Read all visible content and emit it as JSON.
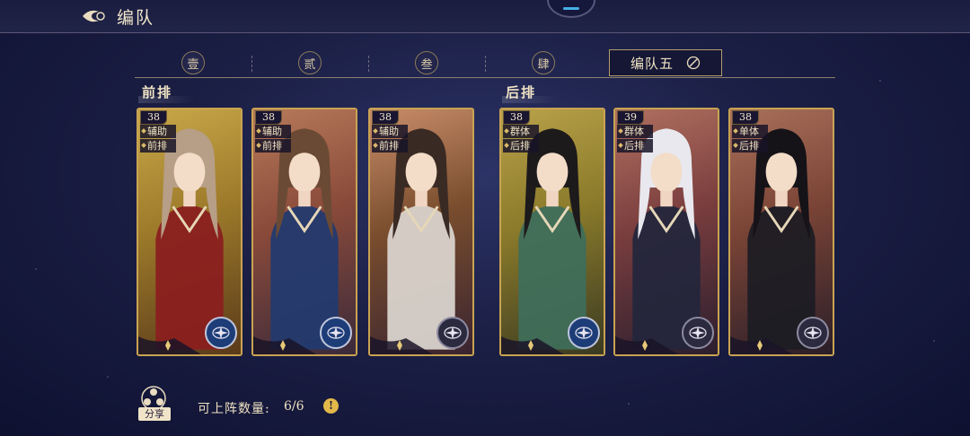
{
  "header": {
    "title": "编队"
  },
  "tabs": [
    {
      "label": "壹"
    },
    {
      "label": "贰"
    },
    {
      "label": "叁"
    },
    {
      "label": "肆"
    },
    {
      "label": "编队五",
      "active": true
    }
  ],
  "sections": {
    "front": "前排",
    "back": "后排"
  },
  "cards": [
    {
      "level": "38",
      "role": "辅助",
      "row": "前排",
      "palette": [
        "#9c7a2a",
        "#c9a84a",
        "#5a3a1a"
      ],
      "hair": "#b79e86",
      "outfit": "#8a1f1f",
      "compass": "blue"
    },
    {
      "level": "38",
      "role": "辅助",
      "row": "前排",
      "palette": [
        "#8a4a3a",
        "#b77a5a",
        "#3a2a3a"
      ],
      "hair": "#6b4a35",
      "outfit": "#233a6e",
      "compass": "blue"
    },
    {
      "level": "38",
      "role": "辅助",
      "row": "前排",
      "palette": [
        "#7a4e2e",
        "#c98d6a",
        "#3a2430"
      ],
      "hair": "#3a2a24",
      "outfit": "#d9d3cc",
      "compass": "dark"
    },
    {
      "level": "38",
      "role": "群体",
      "row": "后排",
      "palette": [
        "#8a7a2a",
        "#b9a24a",
        "#3a3a22"
      ],
      "hair": "#1d1a1c",
      "outfit": "#3f6e5a",
      "compass": "blue"
    },
    {
      "level": "39",
      "role": "群体",
      "row": "后排",
      "palette": [
        "#7a3e3e",
        "#b07060",
        "#2a1e2e"
      ],
      "hair": "#e8e8ee",
      "outfit": "#24263c",
      "compass": "dark"
    },
    {
      "level": "38",
      "role": "单体",
      "row": "后排",
      "palette": [
        "#7a4436",
        "#a9705a",
        "#2a1e28"
      ],
      "hair": "#151318",
      "outfit": "#1d1c24",
      "compass": "dark"
    }
  ],
  "footer": {
    "share_label": "分享",
    "count_label": "可上阵数量:",
    "count_value": "6/6",
    "info_glyph": "!"
  },
  "colors": {
    "gold": "#c9a352",
    "accent_blue": "#46b0e6"
  }
}
